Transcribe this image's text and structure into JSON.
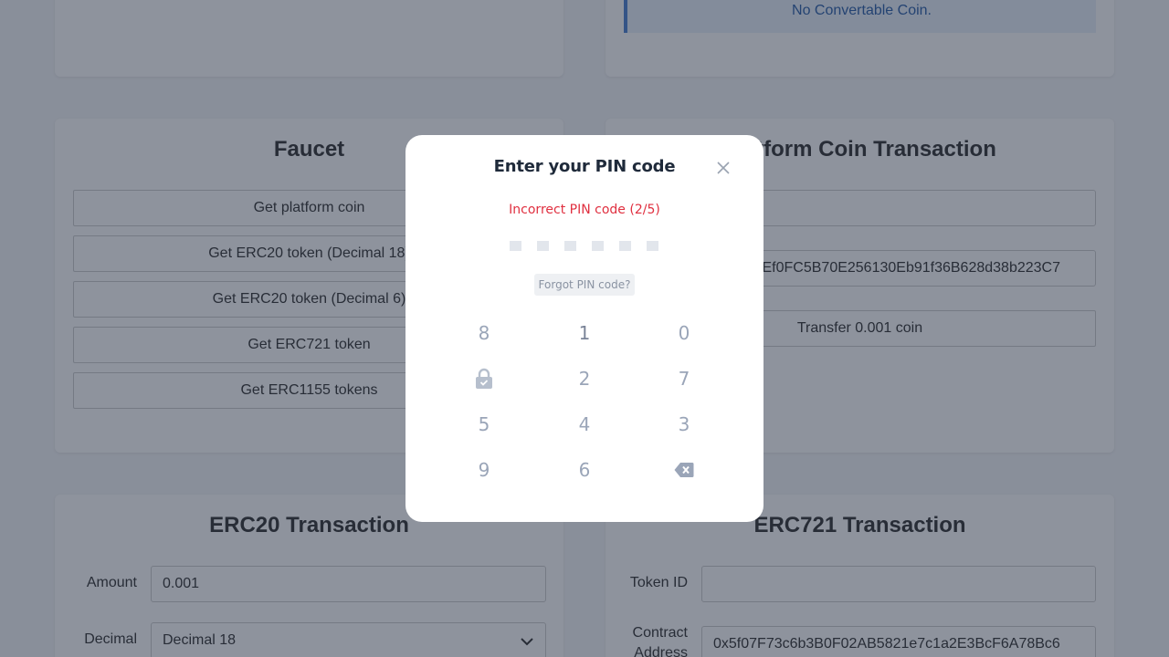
{
  "convert": {
    "alert": "No Convertable Coin."
  },
  "faucet": {
    "title": "Faucet",
    "buttons": [
      "Get platform coin",
      "Get ERC20 token (Decimal 18)",
      "Get ERC20 token (Decimal 6)",
      "Get ERC721 token",
      "Get ERC1155 tokens"
    ]
  },
  "platform_tx": {
    "title": "Platform Coin Transaction",
    "amount": "",
    "address": "0x2a1Ef0FC5B70E256130Eb91f36B628d38b223C7",
    "transfer_label": "Transfer 0.001 coin"
  },
  "erc20_tx": {
    "title": "ERC20 Transaction",
    "amount_label": "Amount",
    "amount_value": "0.001",
    "decimal_label": "Decimal",
    "decimal_value": "Decimal 18"
  },
  "erc721_tx": {
    "title": "ERC721 Transaction",
    "token_id_label": "Token ID",
    "token_id_value": "",
    "contract_label_1": "Contract",
    "contract_label_2": "Address",
    "contract_value": "0x5f07F73c6b3B0F02AB5821e7c1a2E3BcF6A78Bc6"
  },
  "pin_modal": {
    "title": "Enter your PIN code",
    "error": "Incorrect PIN code (2/5)",
    "forgot": "Forgot PIN code?",
    "keys": [
      "8",
      "1",
      "0",
      "lock-icon",
      "2",
      "7",
      "5",
      "4",
      "3",
      "9",
      "6",
      "backspace-icon"
    ],
    "entered_digits": 0,
    "pin_length": 6
  },
  "colors": {
    "error": "#e03040",
    "alert_text": "#2a5ea8",
    "key": "#9aa5b8"
  }
}
